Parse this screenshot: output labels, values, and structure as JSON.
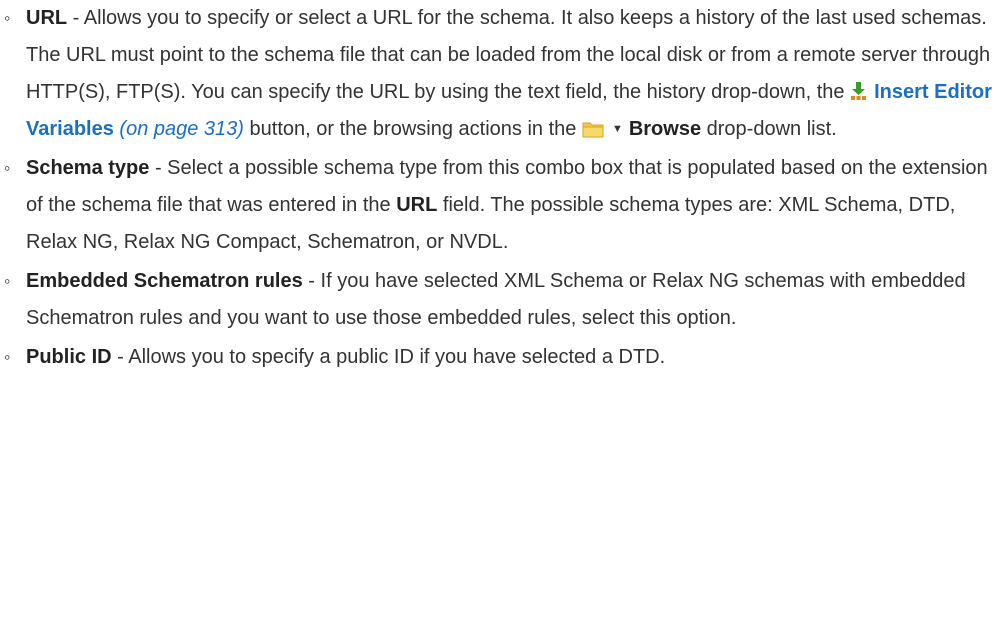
{
  "items": [
    {
      "term": "URL",
      "sep": " - ",
      "text1": "Allows you to specify or select a URL for the schema. It also keeps a history of the last used schemas. The URL must point to the schema file that can be loaded from the local disk or from a remote server through HTTP(S), FTP(S). You can specify the URL by using the text field, the history drop-down, the ",
      "insert_link": "Insert Editor Variables",
      "xref": "(on page 313)",
      "text2": " button, or the browsing actions in the ",
      "browse_label": "Browse",
      "text3": " drop-down list.",
      "icons": [
        "insert-editor-variables-icon",
        "folder-icon",
        "dropdown-caret-icon"
      ]
    },
    {
      "term": "Schema type",
      "sep": " - ",
      "text1": "Select a possible schema type from this combo box that is populated based on the extension of the schema file that was entered in the ",
      "field_ref": "URL",
      "text2": " field. The possible schema types are: XML Schema, DTD, Relax NG, Relax NG Compact, Schematron, or NVDL."
    },
    {
      "term": "Embedded Schematron rules",
      "sep": " - ",
      "text1": "If you have selected XML Schema or Relax NG schemas with embedded Schematron rules and you want to use those embedded rules, select this option."
    },
    {
      "term": "Public ID",
      "sep": " - ",
      "text1": "Allows you to specify a public ID if you have selected a DTD."
    }
  ],
  "colors": {
    "link": "#1a6fc4",
    "text": "#333333",
    "icon_green": "#3a9a2a",
    "icon_orange": "#e08a1e",
    "folder_yellow": "#f2c94c"
  }
}
